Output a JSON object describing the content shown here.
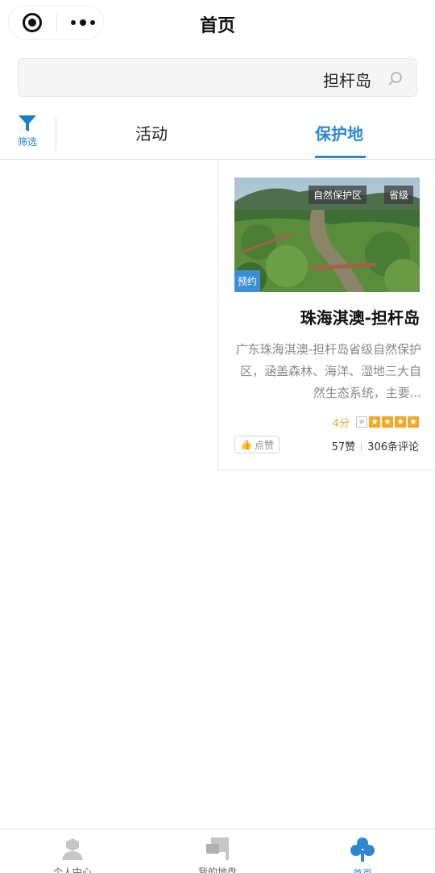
{
  "header": {
    "title": "首页"
  },
  "search": {
    "value": "担杆岛",
    "icon": "search-icon"
  },
  "filter": {
    "label": "筛选",
    "icon": "filter-icon"
  },
  "tabs": [
    {
      "label": "活动",
      "active": false
    },
    {
      "label": "保护地",
      "active": true
    }
  ],
  "card": {
    "level_tag": "省级",
    "type_tag": "自然保护区",
    "booking_tag": "预约",
    "title": "珠海淇澳-担杆岛",
    "description": "广东珠海淇澳-担杆岛省级自然保护区，涵盖森林、海洋、湿地三大自然生态系统，主要...",
    "rating": 4,
    "rating_max": 5,
    "score_label": "4分",
    "comments": "306条评论",
    "likes": "57赞",
    "like_button": "点赞"
  },
  "tabbar": {
    "items": [
      {
        "label": "个人中心",
        "icon": "person-icon",
        "active": false
      },
      {
        "label": "我的地盘",
        "icon": "flag-icon",
        "active": false
      },
      {
        "label": "首页",
        "icon": "home-clover-icon",
        "active": true
      }
    ]
  },
  "colors": {
    "accent": "#2e86d1",
    "star": "#f5a623",
    "booking_tag": "#3a8fd8"
  }
}
